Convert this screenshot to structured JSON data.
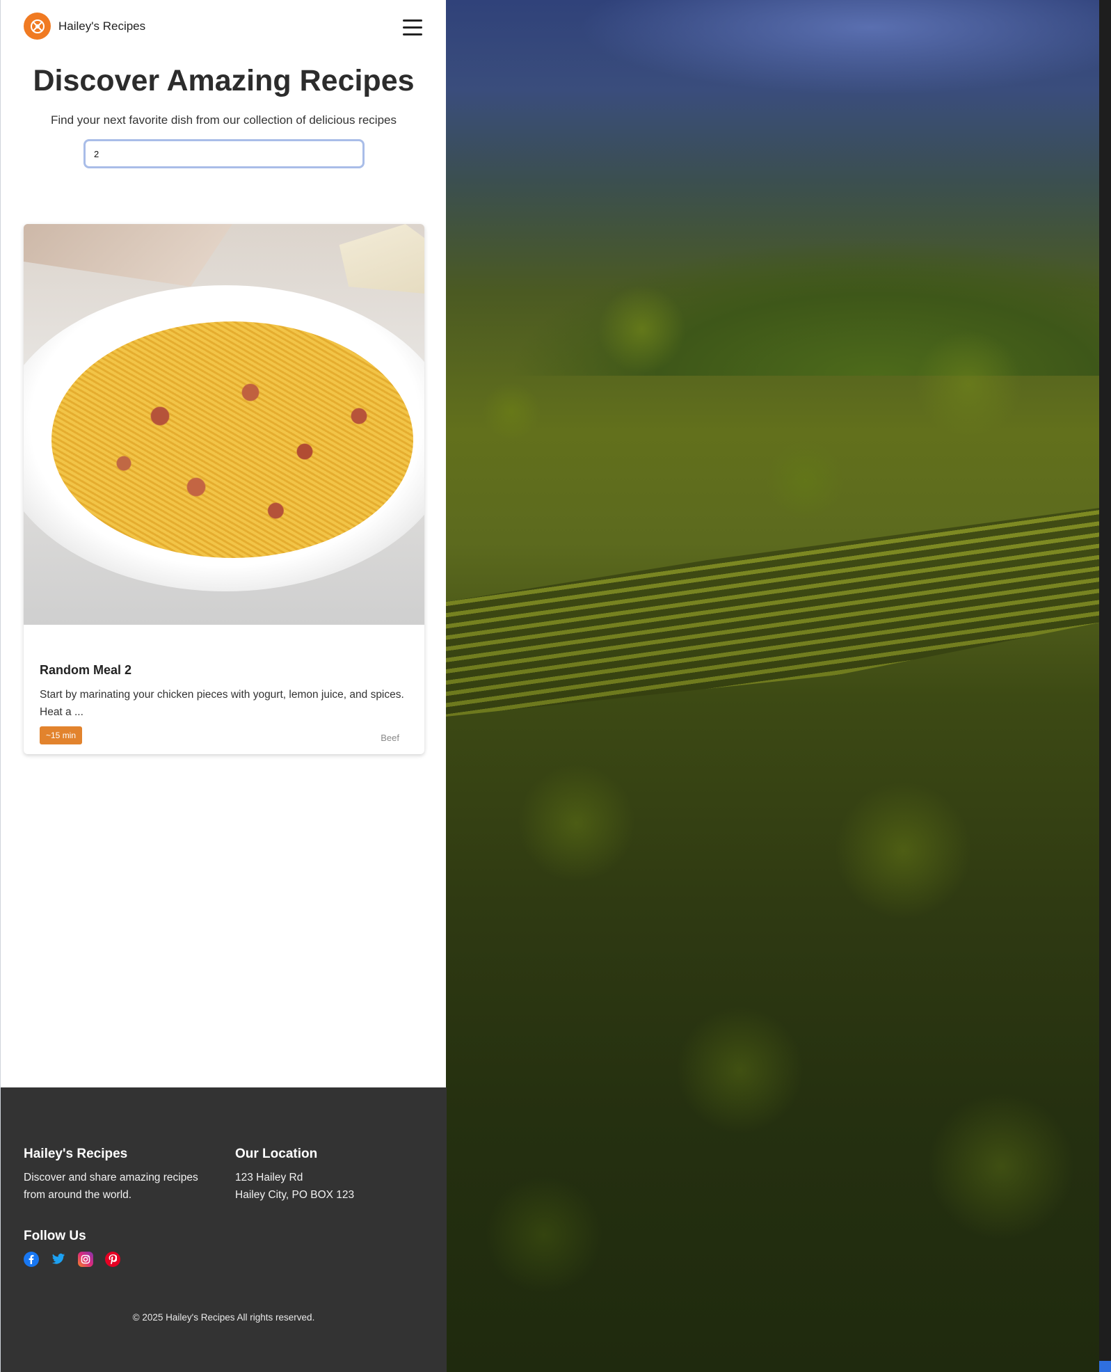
{
  "brand": {
    "name": "Hailey's Recipes",
    "accent_color": "#f07a22"
  },
  "navbar": {
    "menu_icon": "hamburger-menu-icon"
  },
  "hero": {
    "title": "Discover Amazing Recipes",
    "subtitle": "Find your next favorite dish from our collection of delicious recipes"
  },
  "search": {
    "value": "2"
  },
  "recipes": [
    {
      "title": "Random Meal 2",
      "description": "Start by marinating your chicken pieces with yogurt, lemon juice, and spices. Heat a ...",
      "time": "~15 min",
      "category": "Beef"
    }
  ],
  "footer": {
    "about_heading": "Hailey's Recipes",
    "about_text": "Discover and share amazing recipes from around the world.",
    "location_heading": "Our Location",
    "address_line1": "123 Hailey Rd",
    "address_line2": "Hailey City, PO BOX 123",
    "follow_heading": "Follow Us",
    "social": [
      {
        "name": "facebook-icon",
        "color": "#1877f2"
      },
      {
        "name": "twitter-icon",
        "color": "#1da1f2"
      },
      {
        "name": "instagram-icon",
        "color": "#e1306c"
      },
      {
        "name": "pinterest-icon",
        "color": "#e60023"
      }
    ],
    "copyright": "© 2025 Hailey's Recipes All rights reserved."
  }
}
